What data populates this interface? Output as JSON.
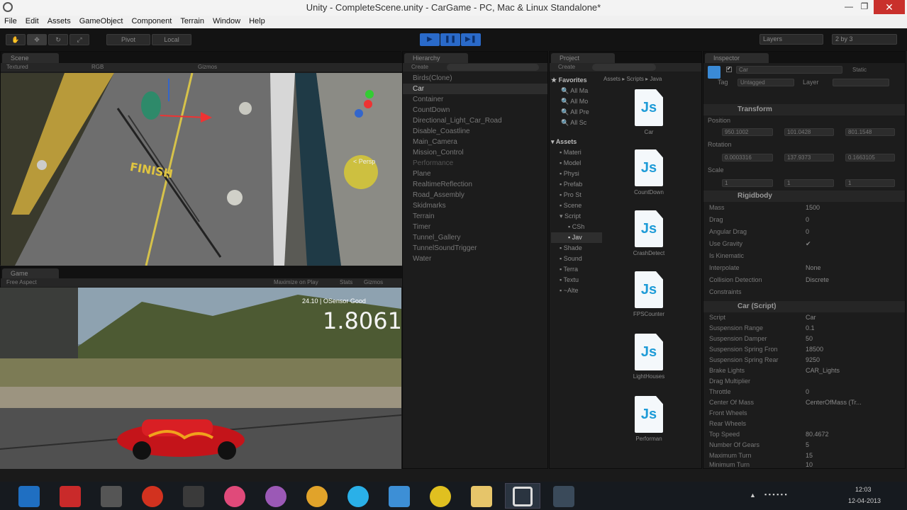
{
  "window": {
    "title": "Unity - CompleteScene.unity - CarGame - PC, Mac & Linux Standalone*"
  },
  "menu": [
    "File",
    "Edit",
    "Assets",
    "GameObject",
    "Component",
    "Terrain",
    "Window",
    "Help"
  ],
  "toolbar": {
    "pivot": "Pivot",
    "local": "Local",
    "layers": "Layers",
    "layout": "2 by 3"
  },
  "scene": {
    "tab": "Scene",
    "mode": "Textured",
    "color": "RGB",
    "gizmos": "Gizmos",
    "persp": "< Persp",
    "finish_text": "FINISH"
  },
  "game": {
    "tab": "Game",
    "aspect": "Free Aspect",
    "maximize": "Maximize on Play",
    "stats": "Stats",
    "gizmos": "Gizmos",
    "fps_overlay": "24.10 | OSensor Good",
    "big_number": "1.8061"
  },
  "hierarchy": {
    "tab": "Hierarchy",
    "create": "Create",
    "items": [
      "Birds(Clone)",
      "Car",
      "Container",
      "CountDown",
      "Directional_Light_Car_Road",
      "Disable_Coastline",
      "Main_Camera",
      "Mission_Control",
      "Performance",
      "Plane",
      "RealtimeReflection",
      "Road_Assembly",
      "Skidmarks",
      "Terrain",
      "Timer",
      "Tunnel_Gallery",
      "TunnelSoundTrigger",
      "Water"
    ]
  },
  "project": {
    "tab": "Project",
    "create": "Create",
    "breadcrumb": "Assets ▸ Scripts ▸ Java",
    "favorites_label": "Favorites",
    "favorites": [
      "All Ma",
      "All Mo",
      "All Pre",
      "All Sc"
    ],
    "assets_label": "Assets",
    "folders": [
      "Materi",
      "Model",
      "Physi",
      "Prefab",
      "Pro St",
      "Scene",
      "Script",
      "CSh",
      "Jav",
      "Shade",
      "Sound",
      "Terra",
      "Textu",
      "~Alte"
    ],
    "scripts": [
      "Car",
      "CountDown",
      "CrashDetect",
      "FPSCounter",
      "LightHouses",
      "Performan"
    ]
  },
  "inspector": {
    "tab": "Inspector",
    "object_name": "Car",
    "static": "Static",
    "tag_label": "Tag",
    "tag_value": "Untagged",
    "layer_label": "Layer",
    "transform": {
      "title": "Transform",
      "position_label": "Position",
      "position": [
        "950.1002",
        "101.0428",
        "801.1548"
      ],
      "rotation_label": "Rotation",
      "rotation": [
        "0.0003316",
        "137.9373",
        "0.1663105"
      ],
      "scale_label": "Scale",
      "scale": [
        "1",
        "1",
        "1"
      ]
    },
    "rigidbody": {
      "title": "Rigidbody",
      "rows": [
        {
          "k": "Mass",
          "v": "1500"
        },
        {
          "k": "Drag",
          "v": "0"
        },
        {
          "k": "Angular Drag",
          "v": "0"
        },
        {
          "k": "Use Gravity",
          "v": "✔"
        },
        {
          "k": "Is Kinematic",
          "v": ""
        },
        {
          "k": "Interpolate",
          "v": "None"
        },
        {
          "k": "Collision Detection",
          "v": "Discrete"
        }
      ],
      "constraints": "Constraints"
    },
    "car_script": {
      "title": "Car (Script)",
      "rows": [
        {
          "k": "Script",
          "v": "Car"
        },
        {
          "k": "Suspension Range",
          "v": "0.1"
        },
        {
          "k": "Suspension Damper",
          "v": "50"
        },
        {
          "k": "Suspension Spring Fron",
          "v": "18500"
        },
        {
          "k": "Suspension Spring Rear",
          "v": "9250"
        },
        {
          "k": "Brake Lights",
          "v": "CAR_Lights"
        },
        {
          "k": "Drag Multiplier",
          "v": ""
        },
        {
          "k": "Throttle",
          "v": "0"
        },
        {
          "k": "Center Of Mass",
          "v": "CenterOfMass (Tr..."
        },
        {
          "k": "Front Wheels",
          "v": ""
        },
        {
          "k": "Rear Wheels",
          "v": ""
        },
        {
          "k": "Top Speed",
          "v": "80.4672"
        },
        {
          "k": "Number Of Gears",
          "v": "5"
        },
        {
          "k": "Maximum Turn",
          "v": "15"
        },
        {
          "k": "Minimum Turn",
          "v": "10"
        }
      ]
    }
  },
  "taskbar": {
    "time": "12:03",
    "date": "12-04-2013",
    "apps": [
      "ie-icon",
      "power-icon",
      "mouse-app-icon",
      "chrome-red-icon",
      "dead-game-icon",
      "b-app-icon",
      "paint-icon",
      "media-icon",
      "skype-icon",
      "dropbox-icon",
      "chrome-icon",
      "folder-icon",
      "unity-icon",
      "network-icon"
    ]
  },
  "colors": {
    "selection_blue": "#2a6ac9",
    "panel_bg": "#1c1c1c",
    "close_red": "#c9302c"
  }
}
